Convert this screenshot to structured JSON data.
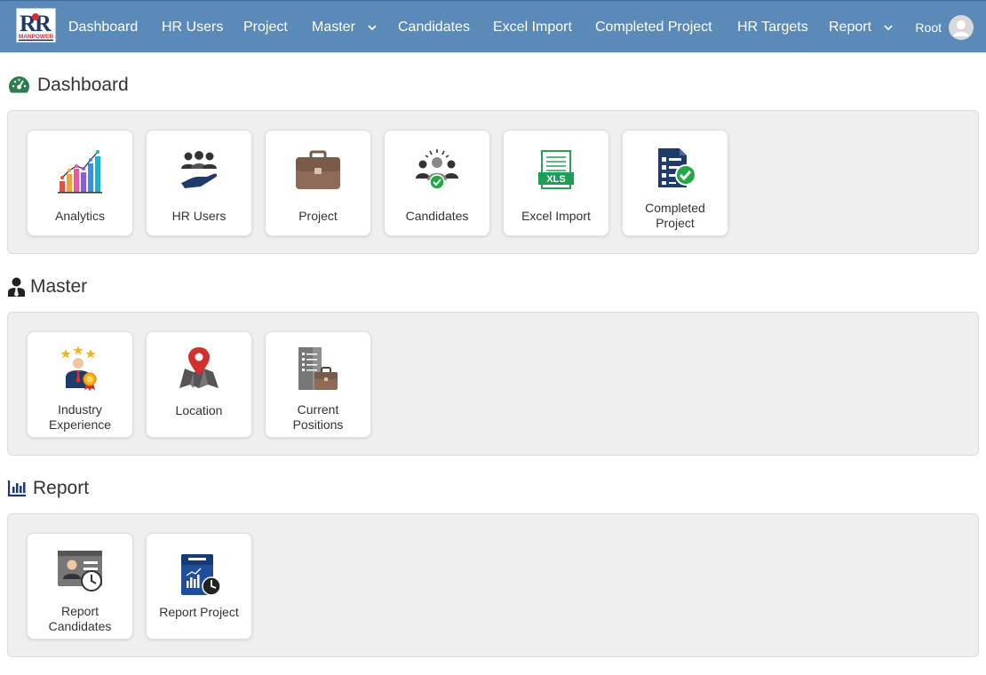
{
  "navbar": {
    "logo_text": "MANPOWER",
    "items": [
      {
        "label": "Dashboard"
      },
      {
        "label": "HR Users"
      },
      {
        "label": "Project"
      },
      {
        "label": "Master"
      },
      {
        "label": "Candidates"
      },
      {
        "label": "Excel Import"
      },
      {
        "label": "Completed Project"
      },
      {
        "label": "HR Targets"
      },
      {
        "label": "Report"
      }
    ],
    "user": {
      "name": "Root"
    }
  },
  "sections": {
    "dashboard": {
      "title": "Dashboard",
      "cards": [
        {
          "label": "Analytics",
          "icon": "analytics-icon"
        },
        {
          "label": "HR Users",
          "icon": "hr-users-icon"
        },
        {
          "label": "Project",
          "icon": "briefcase-icon"
        },
        {
          "label": "Candidates",
          "icon": "candidates-icon"
        },
        {
          "label": "Excel Import",
          "icon": "xls-icon",
          "icon_text": "XLS"
        },
        {
          "label": "Completed Project",
          "icon": "checklist-icon"
        }
      ]
    },
    "master": {
      "title": "Master",
      "cards": [
        {
          "label": "Industry Experience",
          "icon": "award-person-icon"
        },
        {
          "label": "Location",
          "icon": "map-pin-icon"
        },
        {
          "label": "Current Positions",
          "icon": "building-briefcase-icon"
        }
      ]
    },
    "report": {
      "title": "Report",
      "cards": [
        {
          "label": "Report Candidates",
          "icon": "id-card-clock-icon"
        },
        {
          "label": "Report Project",
          "icon": "report-chart-icon"
        }
      ]
    }
  },
  "colors": {
    "navbar_bg": "#5a8ab7",
    "panel_bg": "#efefef",
    "dashboard_icon": "#2e7d4f",
    "navy": "#1f3a6b",
    "green_check": "#22a845"
  }
}
